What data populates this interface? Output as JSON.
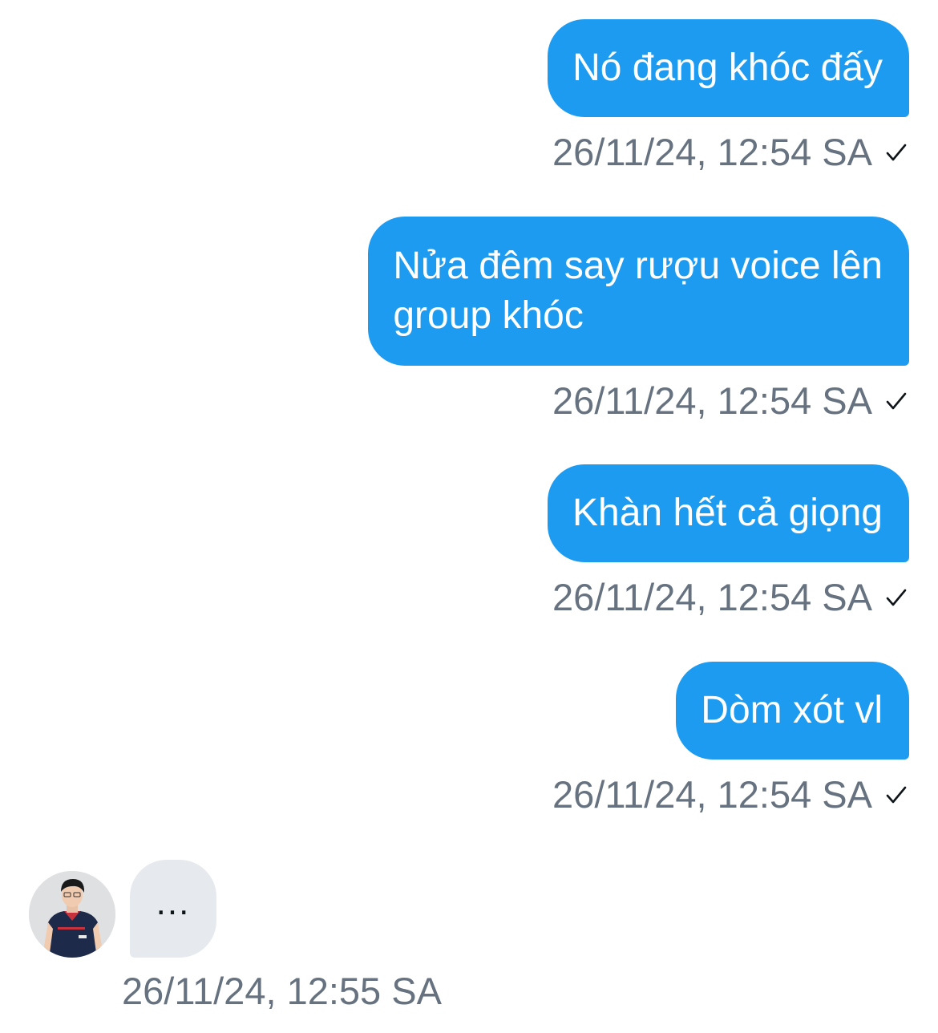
{
  "messages_out": [
    {
      "text": "Nó đang khóc đấy",
      "timestamp": "26/11/24, 12:54 SA",
      "status_icon": "check-icon"
    },
    {
      "text": "Nửa đêm say rượu voice lên\ngroup khóc",
      "timestamp": "26/11/24, 12:54 SA",
      "status_icon": "check-icon"
    },
    {
      "text": "Khàn hết cả giọng",
      "timestamp": "26/11/24, 12:54 SA",
      "status_icon": "check-icon"
    },
    {
      "text": "Dòm xót vl",
      "timestamp": "26/11/24, 12:54 SA",
      "status_icon": "check-icon"
    }
  ],
  "message_in": {
    "typing_text": "...",
    "timestamp": "26/11/24, 12:55 SA"
  },
  "colors": {
    "outgoing_bubble": "#1d9bf0",
    "incoming_bubble": "#e6eaee",
    "timestamp": "#66727f"
  }
}
